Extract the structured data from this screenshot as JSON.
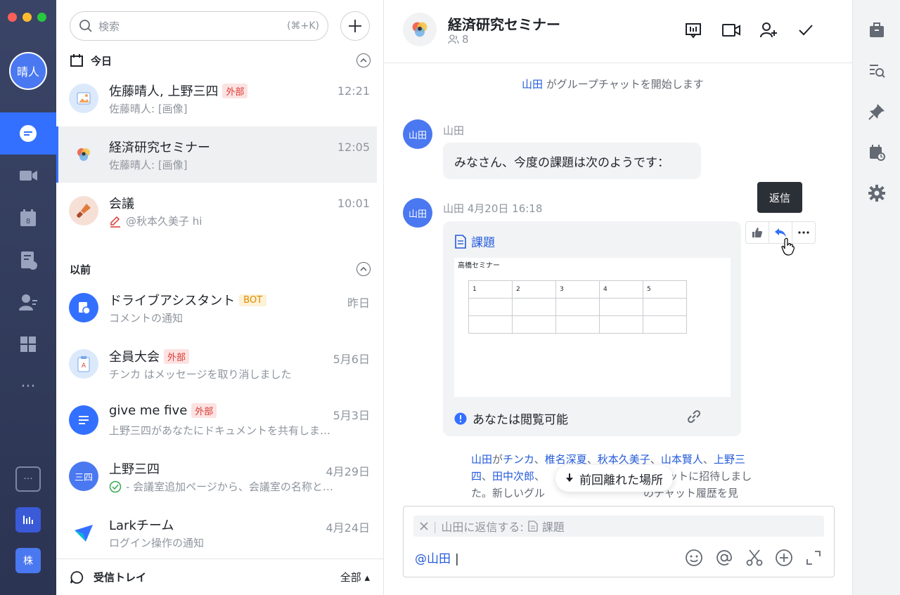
{
  "rail": {
    "me_avatar": "晴人",
    "workspace_label": "株",
    "more": "···"
  },
  "search": {
    "placeholder": "検索",
    "shortcut": "(⌘+K)"
  },
  "sections": {
    "today": "今日",
    "earlier": "以前"
  },
  "chats_today": [
    {
      "name": "佐藤晴人, 上野三四",
      "tag": "外部",
      "time": "12:21",
      "preview": "佐藤晴人: [画像]"
    },
    {
      "name": "経済研究セミナー",
      "tag": "",
      "time": "12:05",
      "preview": "佐藤晴人: [画像]"
    },
    {
      "name": "会議",
      "tag": "",
      "time": "10:01",
      "preview": "@秋本久美子 hi"
    }
  ],
  "chats_earlier": [
    {
      "name": "ドライブアシスタント",
      "tag": "BOT",
      "time": "昨日",
      "preview": "コメントの通知"
    },
    {
      "name": "全員大会",
      "tag": "外部",
      "time": "5月6日",
      "preview": "チンカ はメッセージを取り消しました"
    },
    {
      "name": "give me five",
      "tag": "外部",
      "time": "5月3日",
      "preview": "上野三四があなたにドキュメントを共有しま…"
    },
    {
      "name": "上野三四",
      "avatar": "三四",
      "tag": "",
      "time": "4月29日",
      "preview": "- 会議室追加ページから、会議室の名称と…"
    },
    {
      "name": "Larkチーム",
      "tag": "",
      "time": "4月24日",
      "preview": "ログイン操作の通知"
    }
  ],
  "inbox": {
    "label": "受信トレイ",
    "filter": "全部 ▴"
  },
  "chat": {
    "title": "経済研究セミナー",
    "members": "8",
    "system_user": "山田",
    "system_text": " がグループチャットを開始します",
    "msg1": {
      "avatar": "山田",
      "sender": "山田",
      "text": "みなさん、今度の課題は次のようです："
    },
    "msg2": {
      "avatar": "山田",
      "meta": "山田  4月20日 16:18",
      "doc_title": "課題",
      "doc_heading": "高橋セミナー",
      "doc_cols": [
        "1",
        "2",
        "3",
        "4",
        "5"
      ],
      "permission": "あなたは閲覧可能"
    },
    "tooltip": "返信",
    "invite": {
      "inviter": "山田",
      "ga": "が",
      "names": [
        "チンカ",
        "椎名深夏",
        "秋本久美子",
        "山本賢人",
        "上野三",
        "四",
        "田中次郎"
      ],
      "tail_1": "ットに招待しまし",
      "tail_2": "た。新しいグル",
      "tail_3": "のチャット履歴を見"
    },
    "jump_label": "前回離れた場所",
    "composer": {
      "reply_label": "山田に返信する:",
      "reply_doc": "課題",
      "input": "@山田"
    }
  }
}
